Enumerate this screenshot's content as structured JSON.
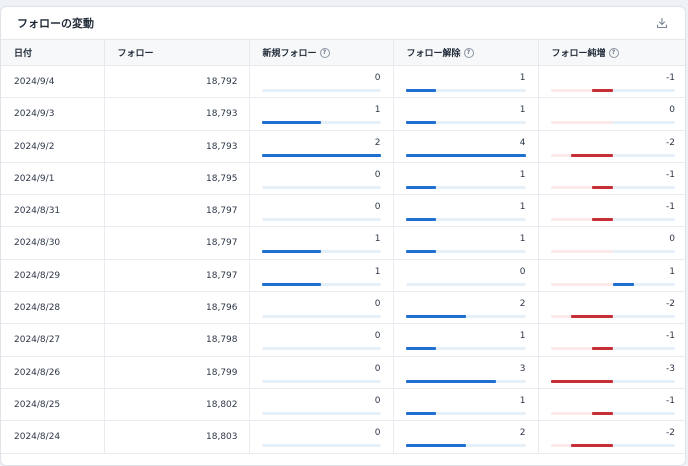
{
  "card": {
    "title": "フォローの変動",
    "download_icon": "download-icon"
  },
  "columns": {
    "date": "日付",
    "follow": "フォロー",
    "new": "新規フォロー",
    "unfollow": "フォロー解除",
    "net": "フォロー純増",
    "help_symbol": "?"
  },
  "colors": {
    "positive_bar": "#1f6fd1",
    "negative_bar": "#c62f35",
    "track": "#e5f0f9",
    "negative_track": "#fde8ea"
  },
  "scale": {
    "new_max": 2,
    "unfollow_max": 4,
    "net_max": 3
  },
  "rows": [
    {
      "date": "2024/9/4",
      "follow": "18,792",
      "new": "0",
      "unfollow": "1",
      "net": "-1"
    },
    {
      "date": "2024/9/3",
      "follow": "18,793",
      "new": "1",
      "unfollow": "1",
      "net": "0"
    },
    {
      "date": "2024/9/2",
      "follow": "18,793",
      "new": "2",
      "unfollow": "4",
      "net": "-2"
    },
    {
      "date": "2024/9/1",
      "follow": "18,795",
      "new": "0",
      "unfollow": "1",
      "net": "-1"
    },
    {
      "date": "2024/8/31",
      "follow": "18,797",
      "new": "0",
      "unfollow": "1",
      "net": "-1"
    },
    {
      "date": "2024/8/30",
      "follow": "18,797",
      "new": "1",
      "unfollow": "1",
      "net": "0"
    },
    {
      "date": "2024/8/29",
      "follow": "18,797",
      "new": "1",
      "unfollow": "0",
      "net": "1"
    },
    {
      "date": "2024/8/28",
      "follow": "18,796",
      "new": "0",
      "unfollow": "2",
      "net": "-2"
    },
    {
      "date": "2024/8/27",
      "follow": "18,798",
      "new": "0",
      "unfollow": "1",
      "net": "-1"
    },
    {
      "date": "2024/8/26",
      "follow": "18,799",
      "new": "0",
      "unfollow": "3",
      "net": "-3"
    },
    {
      "date": "2024/8/25",
      "follow": "18,802",
      "new": "0",
      "unfollow": "1",
      "net": "-1"
    },
    {
      "date": "2024/8/24",
      "follow": "18,803",
      "new": "0",
      "unfollow": "2",
      "net": "-2"
    }
  ]
}
